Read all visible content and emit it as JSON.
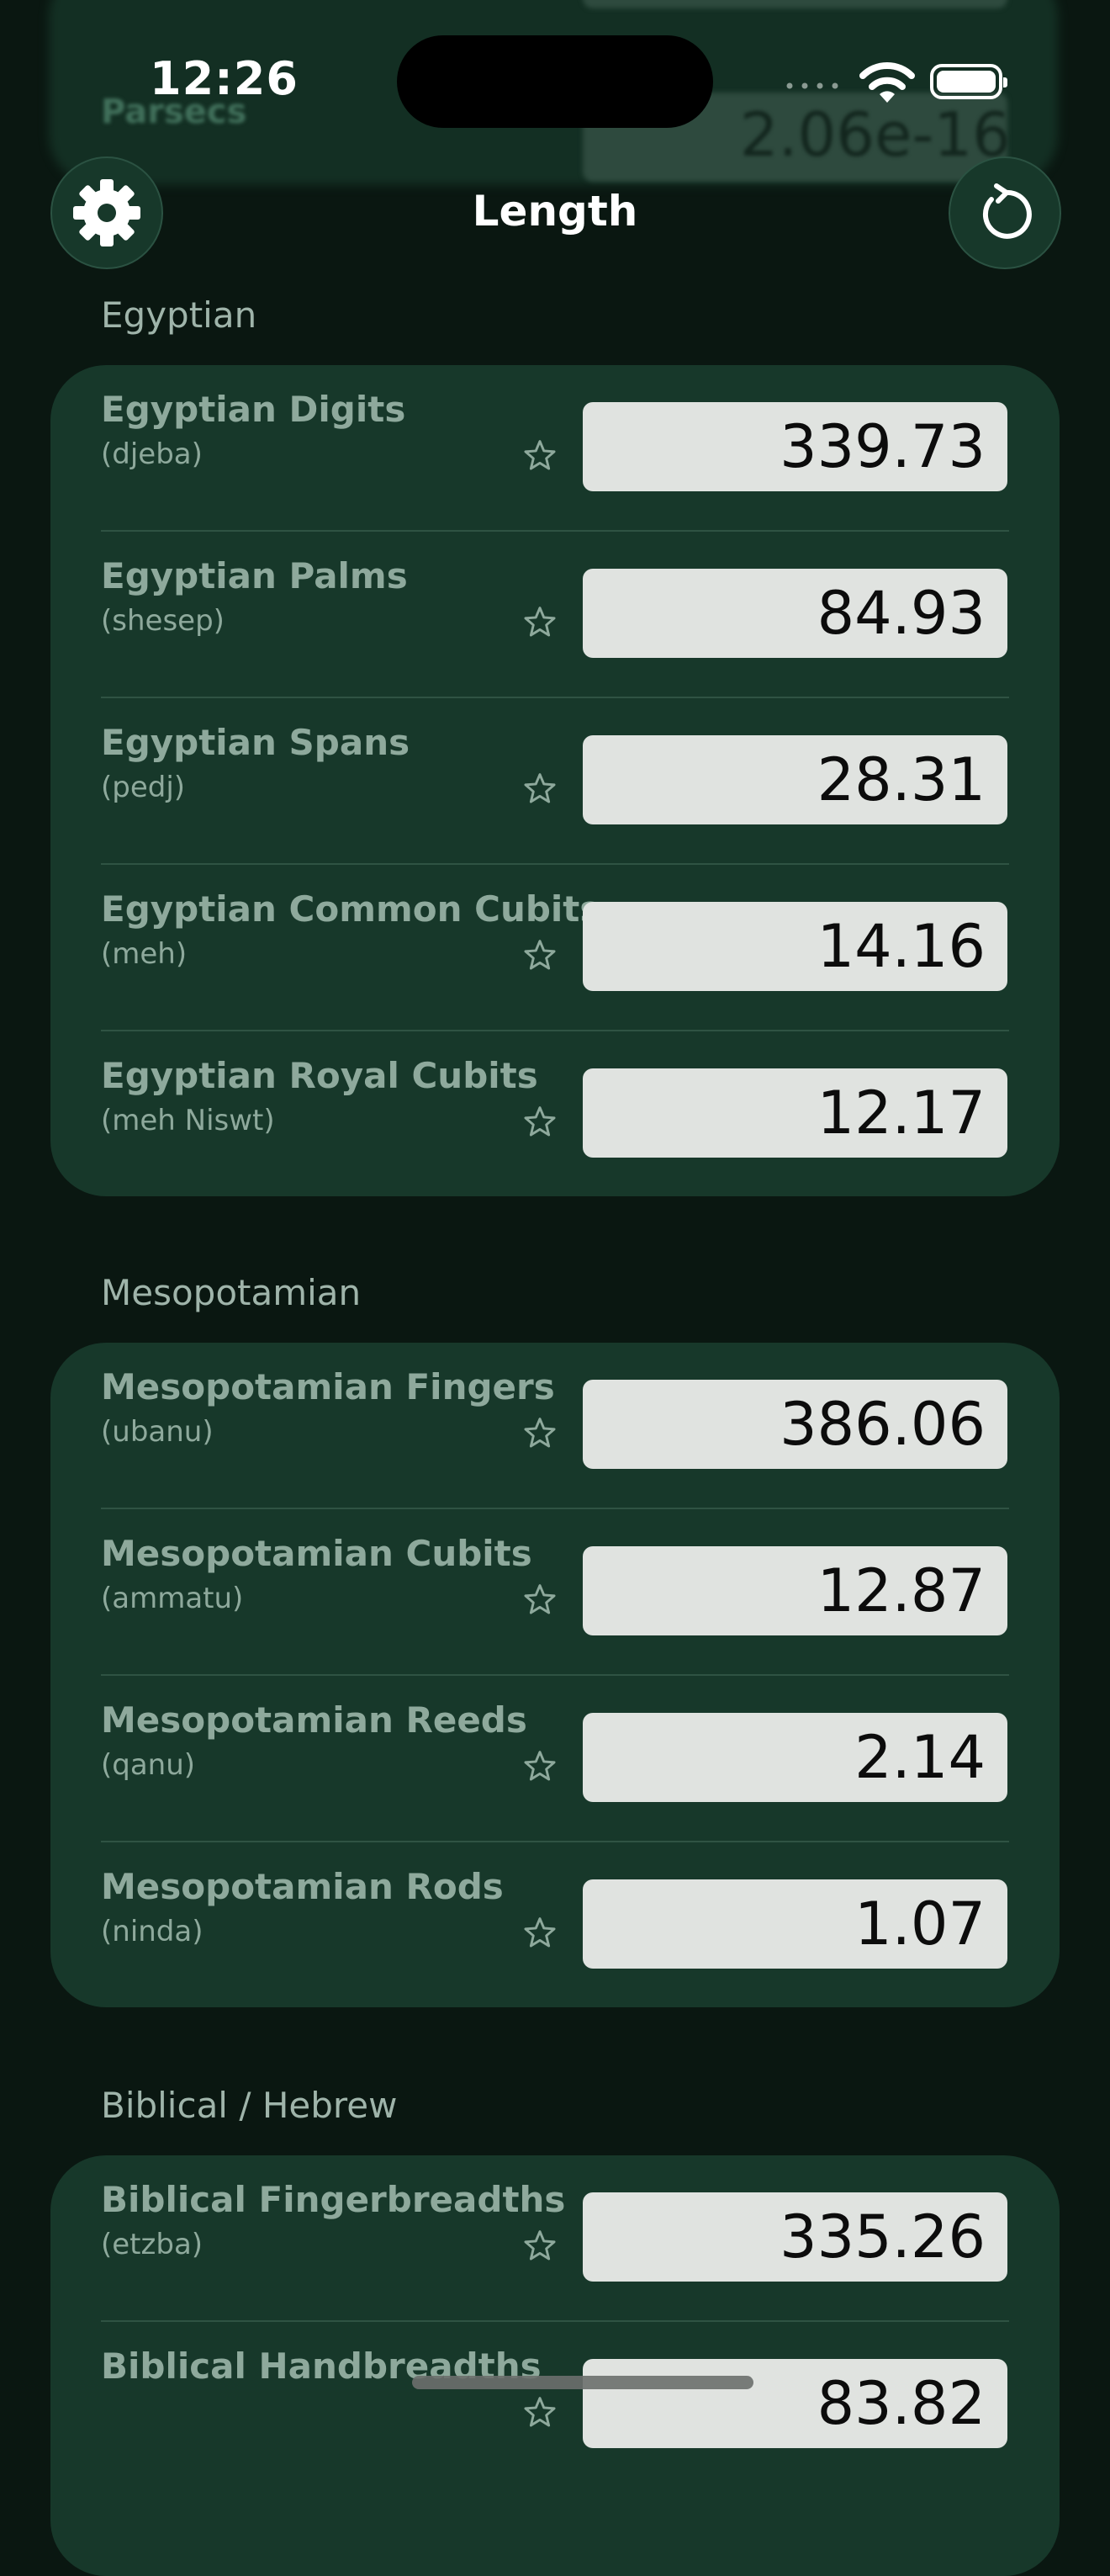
{
  "status_bar": {
    "time": "12:26"
  },
  "header": {
    "title": "Length",
    "settings_icon": "gear-icon",
    "reset_icon": "reset-icon"
  },
  "ghost_row": {
    "name": "Parsecs",
    "value": "2.06e-16"
  },
  "sections": [
    {
      "label": "Egyptian",
      "rows": [
        {
          "name": "Egyptian Digits",
          "sub": "(djeba)",
          "value": "339.73"
        },
        {
          "name": "Egyptian Palms",
          "sub": "(shesep)",
          "value": "84.93"
        },
        {
          "name": "Egyptian Spans",
          "sub": "(pedj)",
          "value": "28.31"
        },
        {
          "name": "Egyptian Common Cubits",
          "sub": "(meh)",
          "value": "14.16"
        },
        {
          "name": "Egyptian Royal Cubits",
          "sub": "(meh Niswt)",
          "value": "12.17"
        }
      ]
    },
    {
      "label": "Mesopotamian",
      "rows": [
        {
          "name": "Mesopotamian Fingers",
          "sub": "(ubanu)",
          "value": "386.06"
        },
        {
          "name": "Mesopotamian Cubits",
          "sub": "(ammatu)",
          "value": "12.87"
        },
        {
          "name": "Mesopotamian Reeds",
          "sub": "(qanu)",
          "value": "2.14"
        },
        {
          "name": "Mesopotamian Rods",
          "sub": "(ninda)",
          "value": "1.07"
        }
      ]
    },
    {
      "label": "Biblical / Hebrew",
      "rows": [
        {
          "name": "Biblical Fingerbreadths",
          "sub": "(etzba)",
          "value": "335.26"
        },
        {
          "name": "Biblical Handbreadths",
          "sub": "",
          "value": "83.82"
        }
      ]
    }
  ]
}
